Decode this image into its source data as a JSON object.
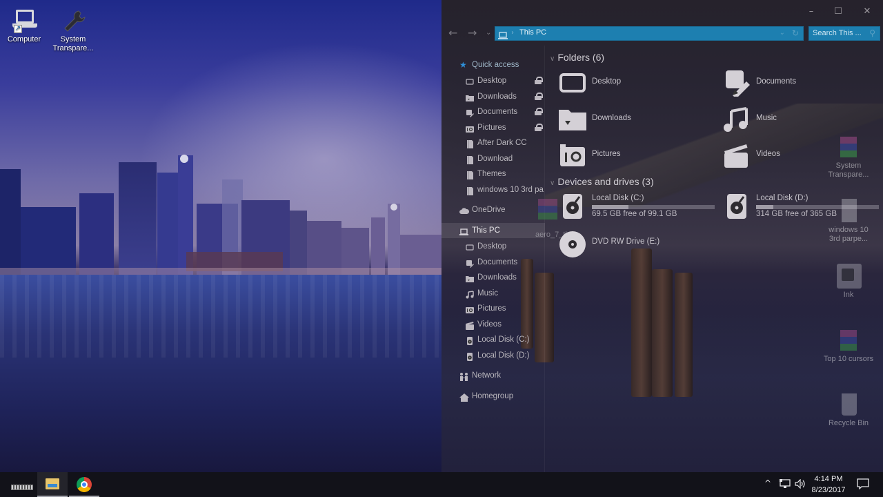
{
  "desktop": {
    "icons_left": [
      {
        "label": "Computer",
        "icon": "laptop-shortcut-icon"
      },
      {
        "label": "System Transpare...",
        "icon": "wrench-icon"
      }
    ],
    "icons_right": [
      {
        "label": "System Transpare...",
        "icon": "winrar-archive-icon"
      },
      {
        "label": "windows 10 3rd parpe...",
        "icon": "file-icon"
      },
      {
        "label": "Ink",
        "icon": "ink-pen-icon"
      },
      {
        "label": "Top 10 cursors",
        "icon": "winrar-archive-icon"
      },
      {
        "label": "Recycle Bin",
        "icon": "recycle-bin-icon"
      }
    ],
    "behind_window_label": "aero_7_th..."
  },
  "explorer": {
    "title_buttons": {
      "minimize": "–",
      "maximize": "☐",
      "close": "✕"
    },
    "nav_buttons": {
      "back": "←",
      "forward": "→",
      "recent": "⌄"
    },
    "address": {
      "breadcrumb_sep": "›",
      "location": "This PC",
      "dropdown": "⌄",
      "refresh": "↻"
    },
    "search": {
      "placeholder": "Search This ...",
      "icon": "⚲"
    },
    "navpane": {
      "quick_access": {
        "label": "Quick access",
        "items": [
          {
            "label": "Desktop",
            "icon": "desktop-icon",
            "pinned": true
          },
          {
            "label": "Downloads",
            "icon": "downloads-folder-icon",
            "pinned": true
          },
          {
            "label": "Documents",
            "icon": "documents-icon",
            "pinned": true
          },
          {
            "label": "Pictures",
            "icon": "pictures-icon",
            "pinned": true
          },
          {
            "label": "After Dark CC",
            "icon": "folder-icon",
            "pinned": false
          },
          {
            "label": "Download",
            "icon": "folder-icon",
            "pinned": false
          },
          {
            "label": "Themes",
            "icon": "folder-icon",
            "pinned": false
          },
          {
            "label": "windows 10 3rd pa",
            "icon": "folder-icon",
            "pinned": false
          }
        ]
      },
      "onedrive": {
        "label": "OneDrive"
      },
      "this_pc": {
        "label": "This PC",
        "items": [
          {
            "label": "Desktop",
            "icon": "desktop-icon"
          },
          {
            "label": "Documents",
            "icon": "documents-icon"
          },
          {
            "label": "Downloads",
            "icon": "downloads-folder-icon"
          },
          {
            "label": "Music",
            "icon": "music-icon"
          },
          {
            "label": "Pictures",
            "icon": "pictures-icon"
          },
          {
            "label": "Videos",
            "icon": "videos-icon"
          },
          {
            "label": "Local Disk (C:)",
            "icon": "drive-icon"
          },
          {
            "label": "Local Disk (D:)",
            "icon": "drive-icon"
          }
        ]
      },
      "network": {
        "label": "Network"
      },
      "homegroup": {
        "label": "Homegroup"
      }
    },
    "content": {
      "folders_header": "Folders (6)",
      "folders": [
        {
          "label": "Desktop",
          "icon": "desktop-icon"
        },
        {
          "label": "Documents",
          "icon": "documents-icon"
        },
        {
          "label": "Downloads",
          "icon": "downloads-folder-icon"
        },
        {
          "label": "Music",
          "icon": "music-icon"
        },
        {
          "label": "Pictures",
          "icon": "pictures-icon"
        },
        {
          "label": "Videos",
          "icon": "videos-icon"
        }
      ],
      "devices_header": "Devices and drives (3)",
      "drives": [
        {
          "label": "Local Disk (C:)",
          "free_text": "69.5 GB free of 99.1 GB",
          "used_fraction": 0.3
        },
        {
          "label": "Local Disk (D:)",
          "free_text": "314 GB free of 365 GB",
          "used_fraction": 0.14
        },
        {
          "label": "DVD RW Drive (E:)"
        }
      ]
    }
  },
  "taskbar": {
    "apps": [
      {
        "name": "keyboard-app",
        "state": "none"
      },
      {
        "name": "file-explorer",
        "state": "active"
      },
      {
        "name": "chrome",
        "state": "open"
      }
    ],
    "tray": {
      "chevron": "^",
      "network": "network-icon",
      "volume": "volume-icon"
    },
    "clock": {
      "time": "4:14 PM",
      "date": "8/23/2017"
    },
    "action_center": "notification-icon"
  },
  "colors": {
    "accent": "#1d7fb0",
    "taskbar": "#121219"
  }
}
